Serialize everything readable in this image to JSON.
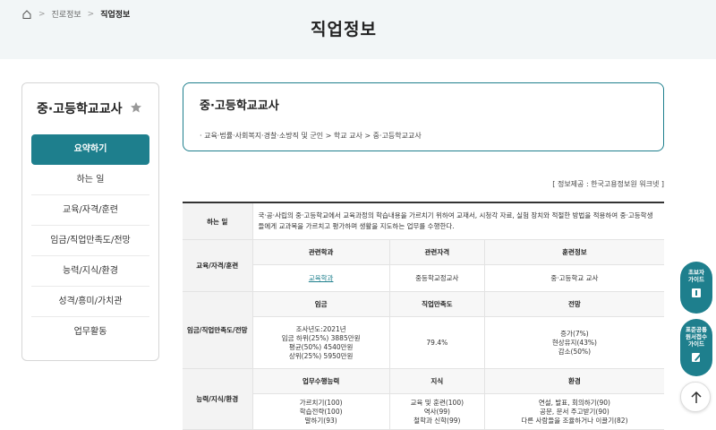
{
  "breadcrumb": {
    "items": [
      "진로정보",
      "직업정보"
    ]
  },
  "page_title": "직업정보",
  "sidebar": {
    "title": "중·고등학교교사",
    "menu": [
      "요약하기",
      "하는 일",
      "교육/자격/훈련",
      "임금/직업만족도/전망",
      "능력/지식/환경",
      "성격/흥미/가치관",
      "업무활동"
    ],
    "active": "요약하기"
  },
  "job": {
    "title": "중·고등학교교사",
    "category_path": "· 교육·법률·사회복지·경찰·소방직 및 군인 > 학교 교사 > 중·고등학교교사"
  },
  "source": "[ 정보제공 : 한국고용정보원 워크넷 ]",
  "table": {
    "duty": {
      "label": "하는 일",
      "text": "국·공·사립의 중·고등학교에서 교육과정의 학습내용을 가르치기 위하여 교재서, 시청각 자료, 실험 장치와 적절한 방법을 적용하여 중·고등학생들에게 교과목을 가르치고 평가하며 생활을 지도하는 업무를 수행한다."
    },
    "education": {
      "label": "교육/자격/훈련",
      "headers": [
        "관련학과",
        "관련자격",
        "훈련정보"
      ],
      "values": [
        "교육학과",
        "중등학교정교사",
        "중·고등학교 교사"
      ]
    },
    "wage": {
      "label": "임금/직업만족도/전망",
      "headers": [
        "임금",
        "직업만족도",
        "전망"
      ],
      "wage_lines": [
        "조사년도:2021년",
        "임금 하위(25%) 3885만원",
        "평균(50%) 4540만원",
        "상위(25%) 5950만원"
      ],
      "satisfaction": "79.4%",
      "outlook_lines": [
        "증가(7%)",
        "현상유지(43%)",
        "감소(50%)"
      ]
    },
    "ability": {
      "label": "능력/지식/환경",
      "headers": [
        "업무수행능력",
        "지식",
        "환경"
      ],
      "ability_lines": [
        "가르치기(100)",
        "학습전략(100)",
        "말하기(93)"
      ],
      "knowledge_lines": [
        "교육 및 훈련(100)",
        "역사(99)",
        "철학과 신학(99)"
      ],
      "env_lines": [
        "연설, 발표, 회의하기(90)",
        "공문, 문서 주고받기(90)",
        "다른 사람들을 조율하거나 이끌기(82)"
      ]
    }
  },
  "floating": {
    "guide1": [
      "초보자",
      "가이드"
    ],
    "guide2": [
      "표준공통",
      "원서접수",
      "가이드"
    ]
  }
}
